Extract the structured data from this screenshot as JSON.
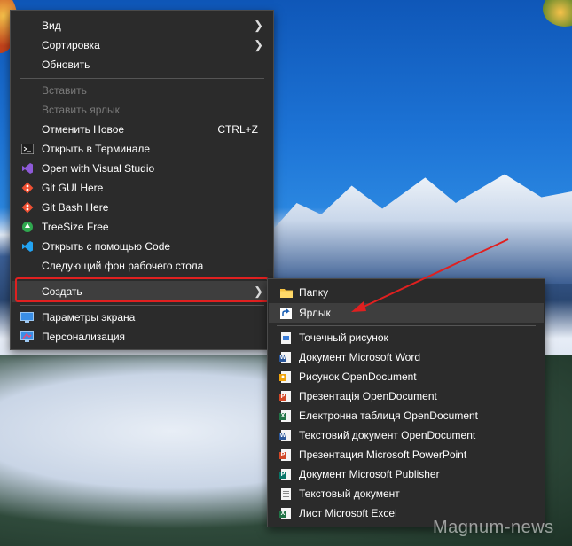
{
  "context_menu": {
    "items": [
      {
        "label": "Вид",
        "has_submenu": true
      },
      {
        "label": "Сортировка",
        "has_submenu": true
      },
      {
        "label": "Обновить"
      },
      {
        "label": "Вставить",
        "disabled": true
      },
      {
        "label": "Вставить ярлык",
        "disabled": true
      },
      {
        "label": "Отменить Новое",
        "shortcut": "CTRL+Z"
      },
      {
        "label": "Открыть в Терминале",
        "icon": "terminal-icon"
      },
      {
        "label": "Open with Visual Studio",
        "icon": "visual-studio-icon"
      },
      {
        "label": "Git GUI Here",
        "icon": "git-icon"
      },
      {
        "label": "Git Bash Here",
        "icon": "git-icon"
      },
      {
        "label": "TreeSize Free",
        "icon": "treesize-icon"
      },
      {
        "label": "Открыть с помощью Code",
        "icon": "vscode-icon"
      },
      {
        "label": "Следующий фон рабочего стола"
      },
      {
        "label": "Создать",
        "has_submenu": true
      },
      {
        "label": "Параметры экрана",
        "icon": "display-settings-icon"
      },
      {
        "label": "Персонализация",
        "icon": "personalization-icon"
      }
    ]
  },
  "create_submenu": {
    "items": [
      {
        "label": "Папку",
        "icon": "folder-icon"
      },
      {
        "label": "Ярлык",
        "icon": "shortcut-icon"
      },
      {
        "label": "Точечный рисунок",
        "icon": "bitmap-icon"
      },
      {
        "label": "Документ Microsoft Word",
        "icon": "word-icon"
      },
      {
        "label": "Рисунок OpenDocument",
        "icon": "odg-icon"
      },
      {
        "label": "Презентація OpenDocument",
        "icon": "odp-icon"
      },
      {
        "label": "Електронна таблиця OpenDocument",
        "icon": "ods-icon"
      },
      {
        "label": "Текстовий документ OpenDocument",
        "icon": "odt-icon"
      },
      {
        "label": "Презентация Microsoft PowerPoint",
        "icon": "powerpoint-icon"
      },
      {
        "label": "Документ Microsoft Publisher",
        "icon": "publisher-icon"
      },
      {
        "label": "Текстовый документ",
        "icon": "text-document-icon"
      },
      {
        "label": "Лист Microsoft Excel",
        "icon": "excel-icon"
      }
    ]
  },
  "watermark": "Magnum-news",
  "colors": {
    "menu_bg": "#2b2b2b",
    "highlight": "#e02020",
    "arrow": "#e02020"
  }
}
